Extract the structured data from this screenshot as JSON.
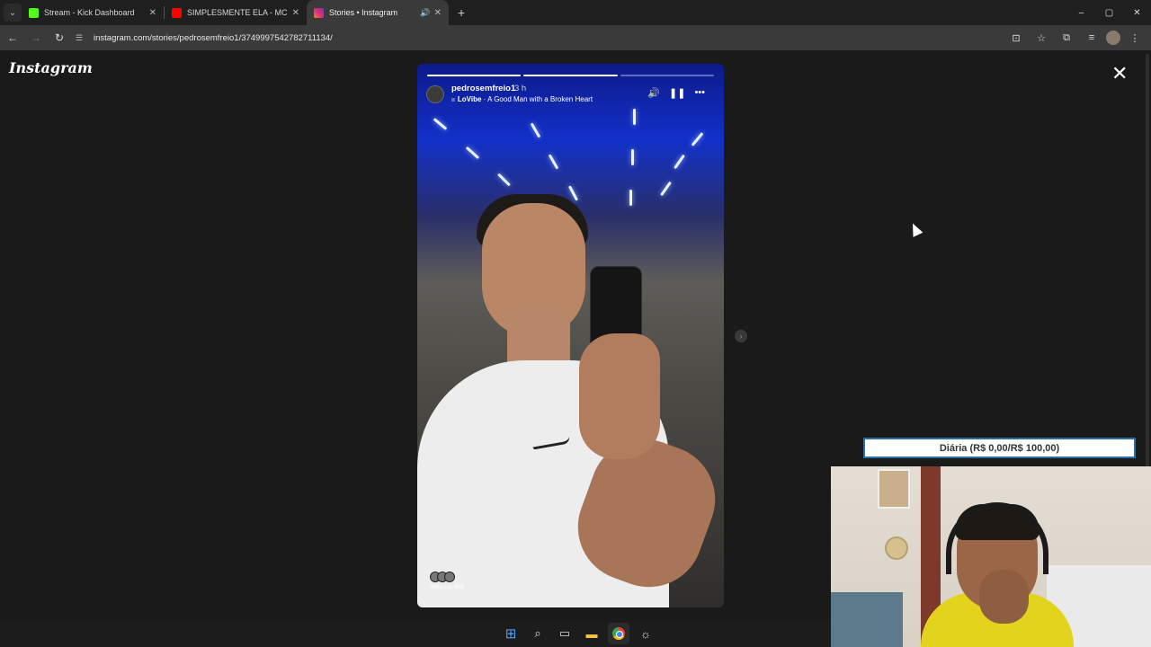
{
  "browser": {
    "tabs": [
      {
        "title": "Stream - Kick Dashboard",
        "color": "#53fc18",
        "active": false
      },
      {
        "title": "SIMPLESMENTE ELA - MC GABI",
        "color": "#ff0000",
        "active": false
      },
      {
        "title": "Stories • Instagram",
        "color": "#e1306c",
        "active": true
      }
    ],
    "url": "instagram.com/stories/pedrosemfreio1/3749997542782711134/"
  },
  "page": {
    "logo": "Instagram"
  },
  "story": {
    "username": "pedrosemfreio1",
    "time": "3 h",
    "music_artist": "LoVibe",
    "music_separator": " · ",
    "music_title": "A Good Man with a Broken Heart",
    "progress": [
      1,
      1,
      0
    ],
    "seen_label": "Visto por 600"
  },
  "overlay": {
    "goal": "Diária (R$ 0,00/R$ 100,00)"
  },
  "icons": {
    "back": "←",
    "forward": "→",
    "reload": "↻",
    "site_info": "☰",
    "install": "⊡",
    "star": "☆",
    "extensions": "⧉",
    "media": "≡",
    "menu": "⋮",
    "minimize": "–",
    "restore": "▢",
    "close": "✕",
    "volume": "🔊",
    "pause": "❚❚",
    "more": "•••",
    "search": "⌕",
    "taskview": "▭",
    "folder": "▬",
    "app": "☼"
  }
}
